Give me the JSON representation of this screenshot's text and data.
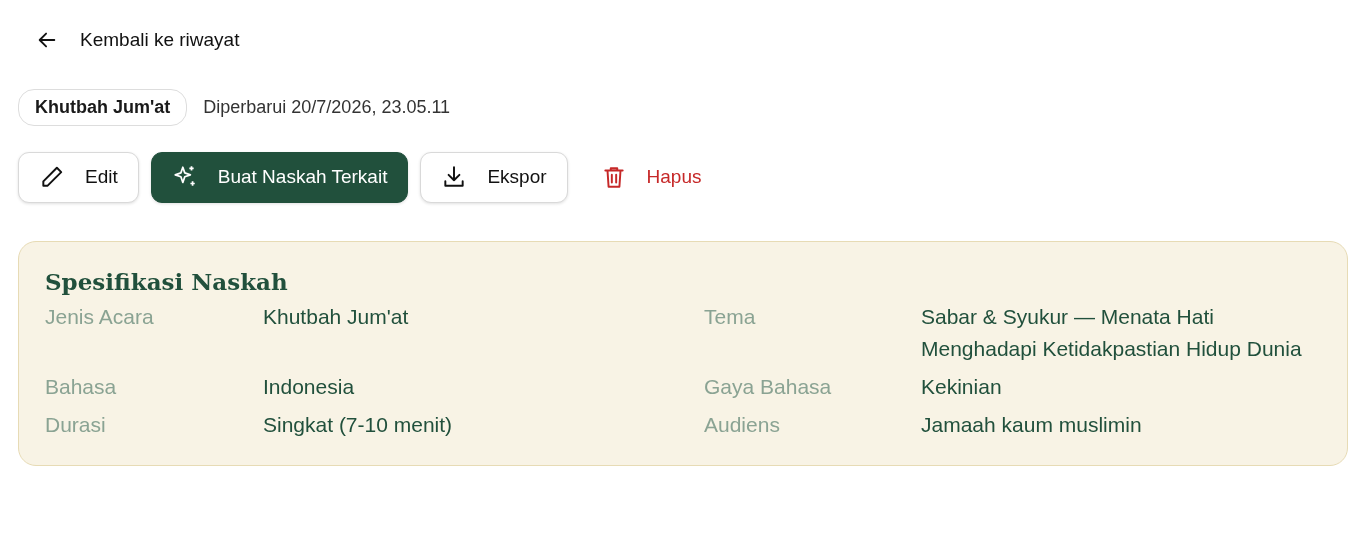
{
  "back_link": {
    "label": "Kembali ke riwayat"
  },
  "category_tag": "Khutbah Jum'at",
  "updated": "Diperbarui 20/7/2026, 23.05.11",
  "actions": [
    {
      "label": "Edit",
      "kind": "edit"
    },
    {
      "label": "Buat Naskah Terkait",
      "kind": "generate"
    },
    {
      "label": "Ekspor",
      "kind": "export"
    },
    {
      "label": "Hapus",
      "kind": "delete"
    }
  ],
  "spec": {
    "title": "Spesifikasi Naskah",
    "fields": [
      {
        "label": "Jenis Acara",
        "value": "Khutbah Jum'at"
      },
      {
        "label": "Tema",
        "value": "Sabar & Syukur — Menata Hati Menghadapi Ketidakpastian Hidup Dunia"
      },
      {
        "label": "Bahasa",
        "value": "Indonesia"
      },
      {
        "label": "Gaya Bahasa",
        "value": "Kekinian"
      },
      {
        "label": "Durasi",
        "value": "Singkat (7-10 menit)"
      },
      {
        "label": "Audiens",
        "value": "Jamaah kaum muslimin"
      }
    ]
  }
}
